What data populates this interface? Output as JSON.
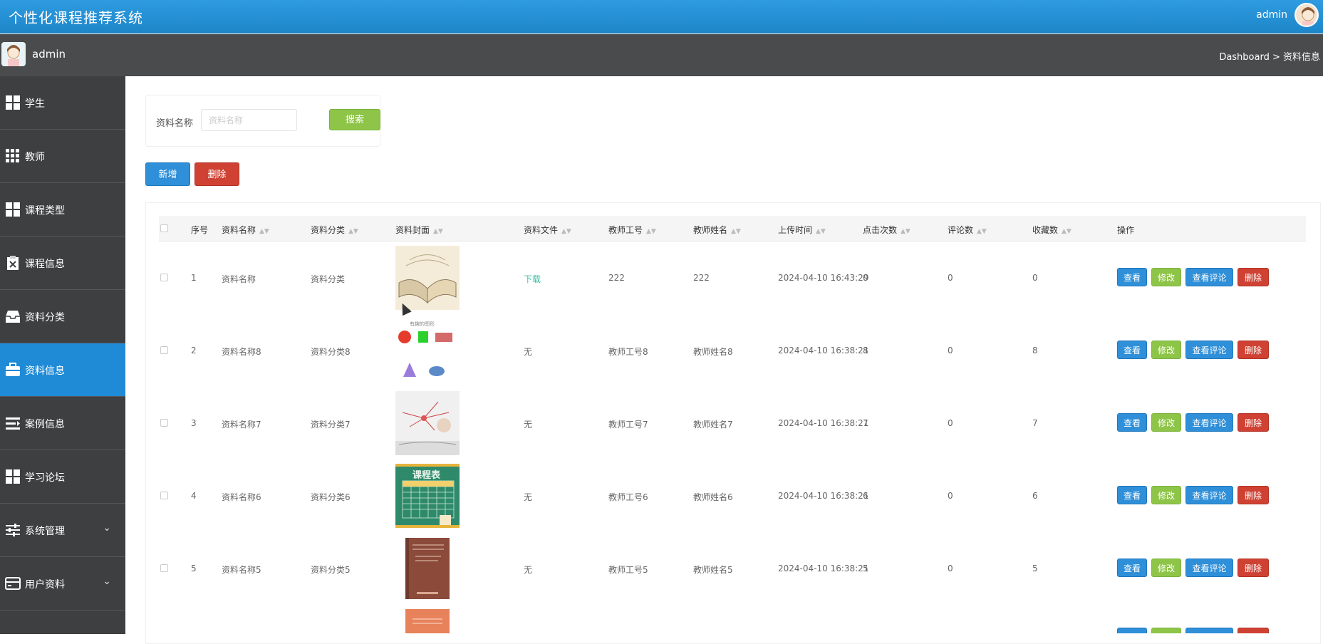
{
  "header": {
    "app_title": "个性化课程推荐系统",
    "user": "admin"
  },
  "subheader": {
    "user": "admin",
    "breadcrumb": "Dashboard > 资料信息"
  },
  "sidebar": {
    "items": [
      {
        "label": "学生",
        "icon": "grid-icon",
        "active": false
      },
      {
        "label": "教师",
        "icon": "apps-icon",
        "active": false
      },
      {
        "label": "课程类型",
        "icon": "grid-icon",
        "active": false
      },
      {
        "label": "课程信息",
        "icon": "clipboard-icon",
        "active": false
      },
      {
        "label": "资料分类",
        "icon": "inbox-icon",
        "active": false
      },
      {
        "label": "资料信息",
        "icon": "briefcase-icon",
        "active": true
      },
      {
        "label": "案例信息",
        "icon": "list-icon",
        "active": false
      },
      {
        "label": "学习论坛",
        "icon": "grid-icon",
        "active": false
      },
      {
        "label": "系统管理",
        "icon": "sliders-icon",
        "active": false,
        "chevron": "⌄"
      },
      {
        "label": "用户资料",
        "icon": "wallet-icon",
        "active": false,
        "chevron": "⌄"
      }
    ]
  },
  "search": {
    "label": "资料名称",
    "placeholder": "资料名称",
    "value": "",
    "button": "搜索"
  },
  "actions": {
    "add": "新增",
    "delete": "删除"
  },
  "table": {
    "columns": [
      "序号",
      "资料名称",
      "资料分类",
      "资料封面",
      "资料文件",
      "教师工号",
      "教师姓名",
      "上传时间",
      "点击次数",
      "评论数",
      "收藏数",
      "操作"
    ],
    "row_actions": {
      "view": "查看",
      "edit": "修改",
      "comments": "查看评论",
      "delete": "删除"
    },
    "rows": [
      {
        "index": "1",
        "name": "资料名称",
        "category": "资料分类",
        "cover": "open-book-cover",
        "file": "下载",
        "teacher_id": "222",
        "teacher_name": "222",
        "upload_time": "2024-04-10 16:43:29",
        "clicks": "0",
        "comments": "0",
        "favorites": "0"
      },
      {
        "index": "2",
        "name": "资料名称8",
        "category": "资料分类8",
        "cover": "shapes-cover",
        "cover_text": "有趣的图形",
        "file": "无",
        "teacher_id": "教师工号8",
        "teacher_name": "教师姓名8",
        "upload_time": "2024-04-10 16:38:21",
        "clicks": "8",
        "comments": "0",
        "favorites": "8"
      },
      {
        "index": "3",
        "name": "资料名称7",
        "category": "资料分类7",
        "cover": "mindmap-cover",
        "file": "无",
        "teacher_id": "教师工号7",
        "teacher_name": "教师姓名7",
        "upload_time": "2024-04-10 16:38:21",
        "clicks": "7",
        "comments": "0",
        "favorites": "7"
      },
      {
        "index": "4",
        "name": "资料名称6",
        "category": "资料分类6",
        "cover": "timetable-cover",
        "cover_text": "课程表",
        "file": "无",
        "teacher_id": "教师工号6",
        "teacher_name": "教师姓名6",
        "upload_time": "2024-04-10 16:38:21",
        "clicks": "6",
        "comments": "0",
        "favorites": "6"
      },
      {
        "index": "5",
        "name": "资料名称5",
        "category": "资料分类5",
        "cover": "brown-book-cover",
        "file": "无",
        "teacher_id": "教师工号5",
        "teacher_name": "教师姓名5",
        "upload_time": "2024-04-10 16:38:21",
        "clicks": "5",
        "comments": "0",
        "favorites": "5"
      }
    ]
  }
}
